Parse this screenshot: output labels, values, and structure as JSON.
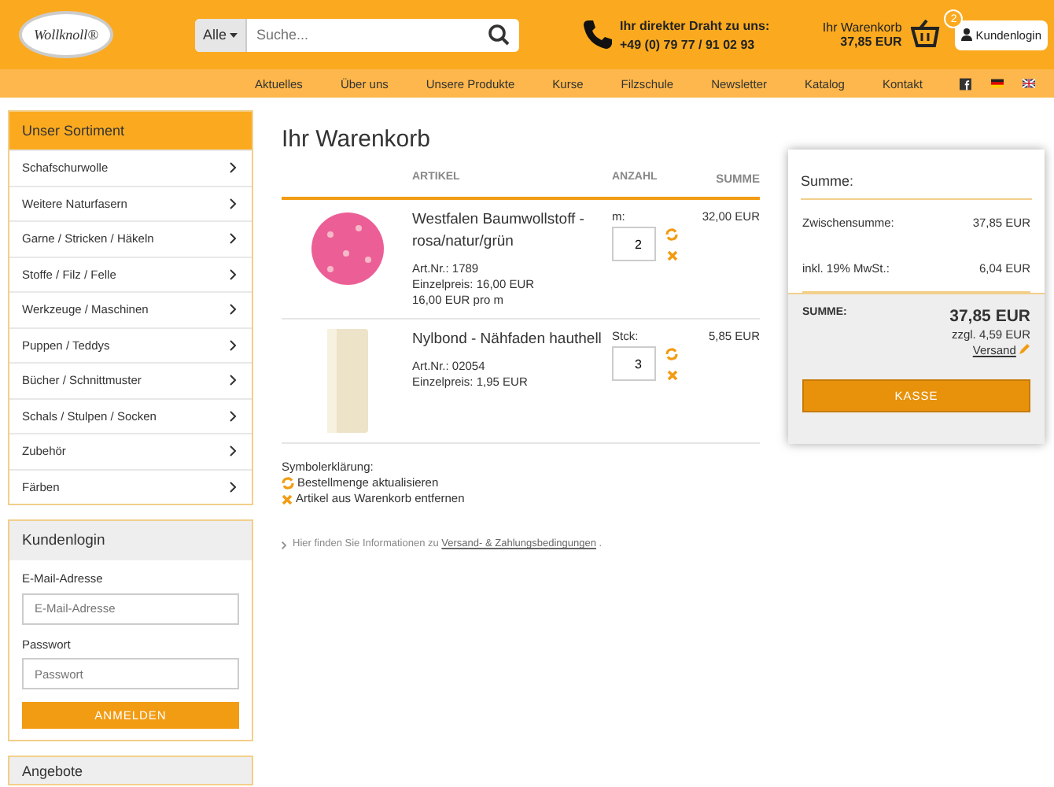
{
  "header": {
    "logo": "Wollknoll®",
    "search": {
      "category": "Alle",
      "placeholder": "Suche..."
    },
    "hotline": {
      "label": "Ihr direkter Draht zu uns:",
      "phone": "+49 (0) 79 77 / 91 02 93"
    },
    "cart": {
      "label": "Ihr Warenkorb",
      "total": "37,85 EUR",
      "count": "2"
    },
    "login_button": "Kundenlogin"
  },
  "nav": [
    "Aktuelles",
    "Über uns",
    "Unsere Produkte",
    "Kurse",
    "Filzschule",
    "Newsletter",
    "Katalog",
    "Kontakt"
  ],
  "sidebar": {
    "title": "Unser Sortiment",
    "items": [
      "Schafschurwolle",
      "Weitere Naturfasern",
      "Garne / Stricken / Häkeln",
      "Stoffe / Filz / Felle",
      "Werkzeuge / Maschinen",
      "Puppen / Teddys",
      "Bücher / Schnittmuster",
      "Schals / Stulpen / Socken",
      "Zubehör",
      "Färben"
    ],
    "login": {
      "title": "Kundenlogin",
      "email_label": "E-Mail-Adresse",
      "email_placeholder": "E-Mail-Adresse",
      "password_label": "Passwort",
      "password_placeholder": "Passwort",
      "button": "ANMELDEN"
    },
    "next_box_title": "Angebote"
  },
  "cart": {
    "title": "Ihr Warenkorb",
    "columns": [
      "ARTIKEL",
      "ANZAHL",
      "SUMME"
    ],
    "rows": [
      {
        "kind": "fabric",
        "name": "Westfalen Baumwollstoff - rosa/natur/grün",
        "details": [
          "Art.Nr.: 1789",
          "Einzelpreis: 16,00 EUR",
          "16,00 EUR pro m"
        ],
        "unit": "m:",
        "quantity": "2",
        "sum": "32,00 EUR"
      },
      {
        "kind": "thread",
        "name": "Nylbond - Nähfaden hauthell",
        "details": [
          "Art.Nr.: 02054",
          "Einzelpreis: 1,95 EUR"
        ],
        "unit": "Stck:",
        "quantity": "3",
        "sum": "5,85 EUR"
      }
    ],
    "legend": {
      "title": "Symbolerklärung:",
      "update": "Bestellmenge aktualisieren",
      "remove": "Artikel aus Warenkorb entfernen"
    },
    "info": {
      "text": "Hier finden Sie Informationen zu",
      "link": "Versand- & Zahlungsbedingungen",
      "after": "."
    }
  },
  "summary": {
    "title": "Summe:",
    "lines": [
      {
        "label": "Zwischensumme:",
        "value": "37,85 EUR"
      },
      {
        "label": "inkl. 19% MwSt.:",
        "value": "6,04 EUR"
      }
    ],
    "total_label": "SUMME:",
    "total": "37,85 EUR",
    "shipping": "zzgl. 4,59 EUR",
    "shipping_link": "Versand",
    "button": "KASSE"
  }
}
